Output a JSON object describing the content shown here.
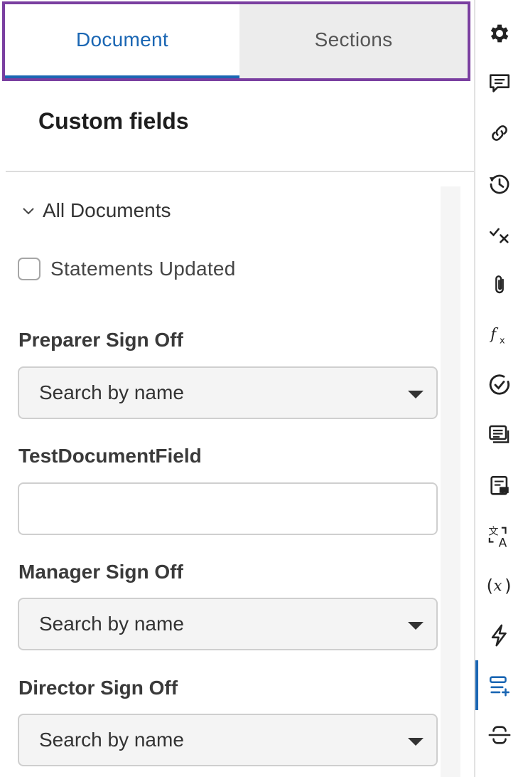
{
  "tabs": {
    "document": "Document",
    "sections": "Sections"
  },
  "title": "Custom fields",
  "group": {
    "label": "All Documents"
  },
  "checkbox": {
    "label": "Statements Updated",
    "checked": false
  },
  "fields": {
    "preparer": {
      "label": "Preparer Sign Off",
      "placeholder": "Search by name"
    },
    "test_document_field": {
      "label": "TestDocumentField",
      "value": ""
    },
    "manager": {
      "label": "Manager Sign Off",
      "placeholder": "Search by name"
    },
    "director": {
      "label": "Director Sign Off",
      "placeholder": "Search by name"
    }
  },
  "sidebar_icons": [
    "settings-icon",
    "comment-icon",
    "link-icon",
    "history-icon",
    "check-x-icon",
    "attachment-icon",
    "formula-icon",
    "check-circle-icon",
    "list-icon",
    "note-icon",
    "translate-icon",
    "variable-icon",
    "lightning-icon",
    "custom-fields-icon",
    "connect-icon"
  ],
  "colors": {
    "accent": "#1a66b3",
    "highlight": "#7a3fa0"
  }
}
